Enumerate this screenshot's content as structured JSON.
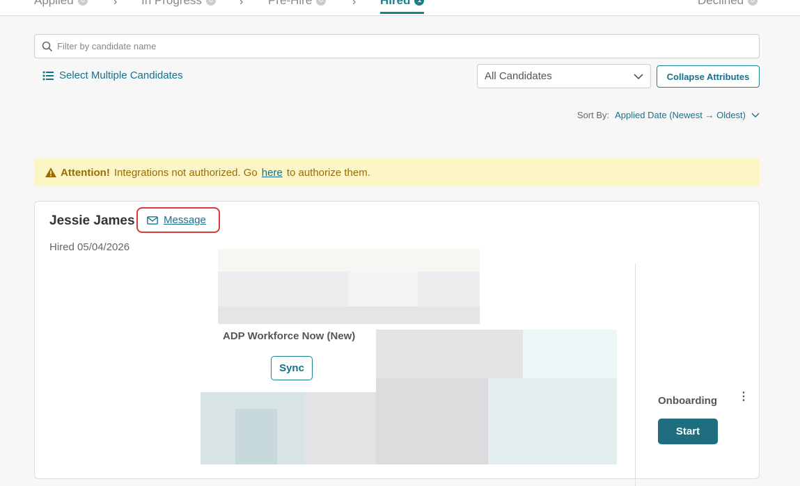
{
  "tabs": [
    {
      "label": "Applied",
      "count": "0"
    },
    {
      "label": "In Progress",
      "count": "0"
    },
    {
      "label": "Pre-Hire",
      "count": "0"
    },
    {
      "label": "Hired",
      "count": "1"
    },
    {
      "label": "Declined",
      "count": "0"
    }
  ],
  "filter": {
    "placeholder": "Filter by candidate name"
  },
  "toolbar": {
    "select_multiple": "Select Multiple Candidates",
    "candidates_dropdown": "All Candidates",
    "collapse_button": "Collapse Attributes"
  },
  "sort": {
    "label": "Sort By:",
    "value": "Applied Date (Newest → Oldest)"
  },
  "alert": {
    "strong": "Attention!",
    "pre": "Integrations not authorized. Go",
    "link": "here",
    "post": "to authorize them."
  },
  "candidate": {
    "name": "Jessie James",
    "message_label": "Message",
    "hired_text": "Hired 05/04/2026",
    "integration": "ADP Workforce Now (New)",
    "sync_label": "Sync",
    "onboarding_label": "Onboarding",
    "start_label": "Start",
    "more_icon": "⋮"
  },
  "colors": {
    "accent": "#17808a",
    "alert_bg": "#fcf6c7",
    "start_bg": "#1e6e80"
  }
}
